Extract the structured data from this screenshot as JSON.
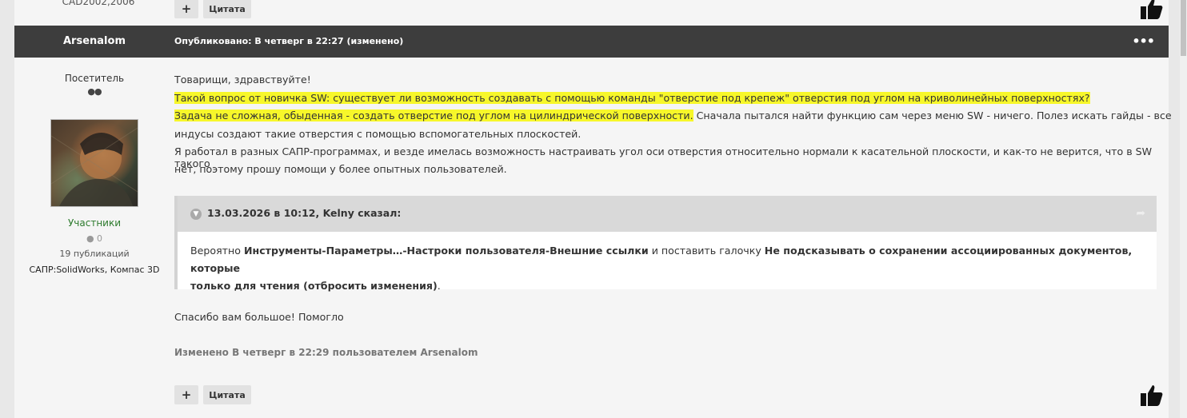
{
  "prev_post": {
    "author_cad": "CAD2002,2006",
    "plus_label": "+",
    "quote_label": "Цитата"
  },
  "post": {
    "author": "Arsenalom",
    "meta": "Опубликовано: В четверг в 22:27 (изменено)",
    "menu_icon": "•••",
    "sidebar": {
      "role": "Посетитель",
      "dots": "●●",
      "group": "Участники",
      "rep": "● 0",
      "posts": "19 публикаций",
      "cad": "САПР:SolidWorks, Компас 3D"
    },
    "body": {
      "line1": "Товарищи, здравствуйте!",
      "line2": "Такой вопрос от новичка SW: существует ли возможность создавать с помощью команды \"отверстие под крепеж\" отверстия под углом на криволинейных поверхностях?",
      "line3a": "Задача не сложная, обыденная - создать отверстие под углом на цилиндрической поверхности.",
      "line3b": " Сначала пытался найти функцию сам через меню SW - ничего. Полез искать гайды -  все",
      "line4": "индусы создают такие отверстия с помощью вспомогательных плоскостей.",
      "line5": "Я работал в разных САПР-программах, и везде имелась возможность настраивать угол оси отверстия относительно нормали к касательной плоскости, и как-то не верится, что в SW такого",
      "line6": "нет, поэтому прошу помощи у более опытных пользователей."
    },
    "quote": {
      "title": "13.03.2026 в 10:12, Kelny сказал:",
      "text1": "Вероятно ",
      "bold1": "Инструменты-Параметры…-Настроки пользователя-Внешние ссылки",
      "text2": " и поставить галочку ",
      "bold2": "Не подсказывать о сохранении ассоциированных документов, которые",
      "bold3": "только для чтения (отбросить изменения)",
      "text3": "."
    },
    "thanks": "Спасибо вам большое! Помогло",
    "edited": "Изменено В четверг в 22:29 пользователем Arsenalom",
    "plus_label": "+",
    "quote_label": "Цитата"
  },
  "colors": {
    "header_bg": "#3d3d3d",
    "highlight": "#f7f72a",
    "group_green": "#2c7a2c"
  }
}
